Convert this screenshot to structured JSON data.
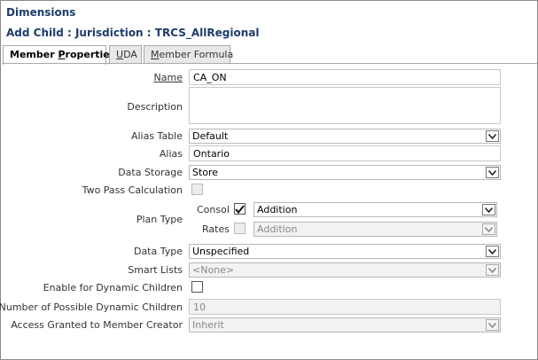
{
  "dialog": {
    "title": "Dimensions",
    "subtitle": "Add Child : Jurisdiction : TRCS_AllRegional"
  },
  "tabs": [
    {
      "label_pre": "Member ",
      "label_u": "P",
      "label_post": "roperties",
      "active": true
    },
    {
      "label_pre": "",
      "label_u": "U",
      "label_post": "DA",
      "active": false
    },
    {
      "label_pre": "",
      "label_u": "M",
      "label_post": "ember Formula",
      "active": false
    }
  ],
  "form": {
    "name_label": "Name",
    "name_value": "CA_ON",
    "description_label": "Description",
    "description_value": "",
    "alias_table_label": "Alias Table",
    "alias_table_value": "Default",
    "alias_label": "Alias",
    "alias_value": "Ontario",
    "data_storage_label": "Data Storage",
    "data_storage_value": "Store",
    "two_pass_label": "Two Pass Calculation",
    "plan_type_label": "Plan Type",
    "consol_label": "Consol",
    "consol_checked": true,
    "consol_agg_value": "Addition",
    "rates_label": "Rates",
    "rates_checked": false,
    "rates_agg_value": "Addition",
    "data_type_label": "Data Type",
    "data_type_value": "Unspecified",
    "smart_lists_label": "Smart Lists",
    "smart_lists_value": "<None>",
    "dynamic_children_label": "Enable for Dynamic Children",
    "num_dynamic_label": "Number of Possible Dynamic Children",
    "num_dynamic_value": "10",
    "access_label": "Access Granted to Member Creator",
    "access_value": "Inherit"
  },
  "icons": {
    "dropdown": "chevron-down-icon",
    "checkmark": "checkmark-icon"
  }
}
